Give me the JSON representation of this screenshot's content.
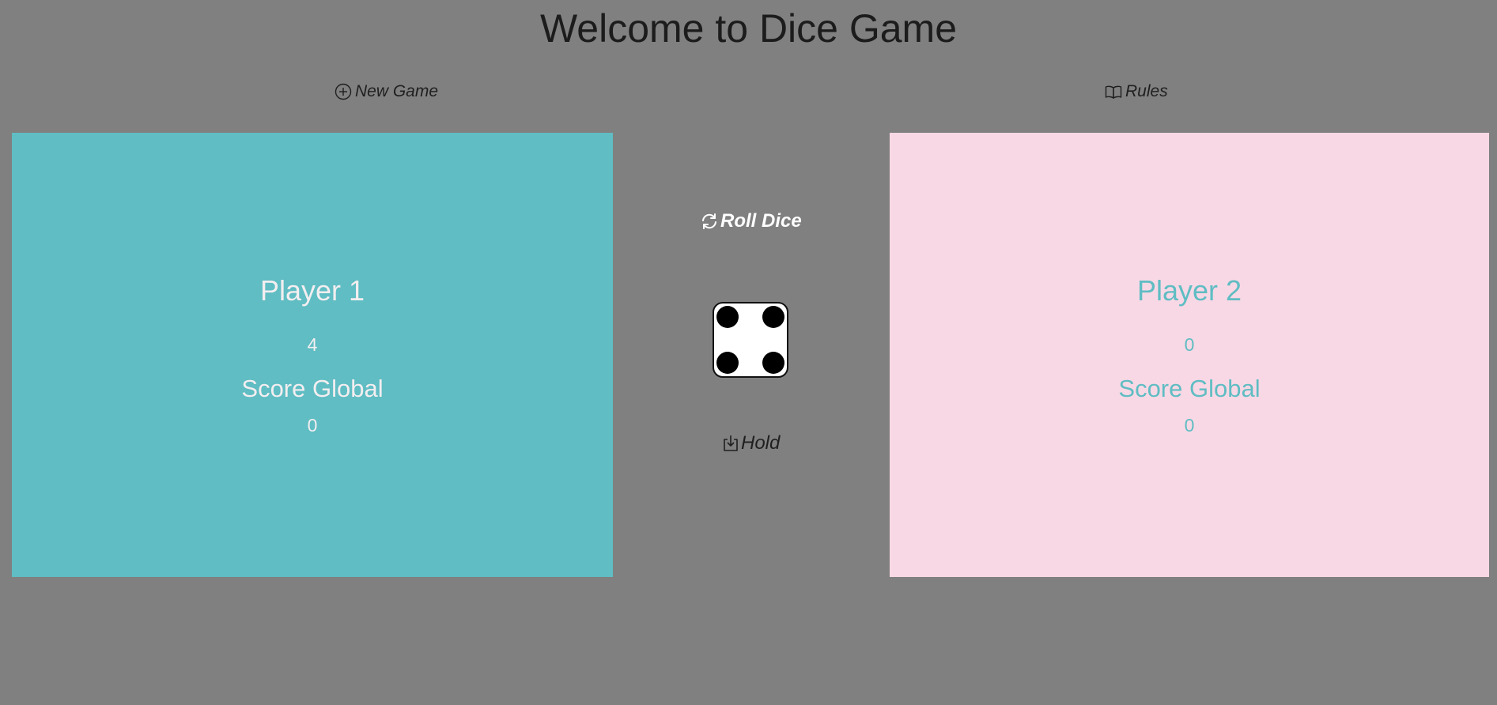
{
  "header": {
    "title": "Welcome to Dice Game"
  },
  "toolbar": {
    "new_game_label": "New Game",
    "new_game_icon": "plus-circle-icon",
    "rules_label": "Rules",
    "rules_icon": "book-icon"
  },
  "players": [
    {
      "name": "Player 1",
      "round_score": "4",
      "global_label": "Score Global",
      "global_score": "0",
      "panel_color": "#5fbdc3",
      "text_color": "#f3eef0"
    },
    {
      "name": "Player 2",
      "round_score": "0",
      "global_label": "Score Global",
      "global_score": "0",
      "panel_color": "#f9d8e5",
      "text_color": "#5fbdc3"
    }
  ],
  "controls": {
    "roll_label": "Roll Dice",
    "roll_icon": "refresh-icon",
    "hold_label": "Hold",
    "hold_icon": "download-tray-icon"
  },
  "dice": {
    "value": 4
  },
  "colors": {
    "background": "#808080",
    "dice_face": "#ffffff",
    "pip": "#000000"
  }
}
